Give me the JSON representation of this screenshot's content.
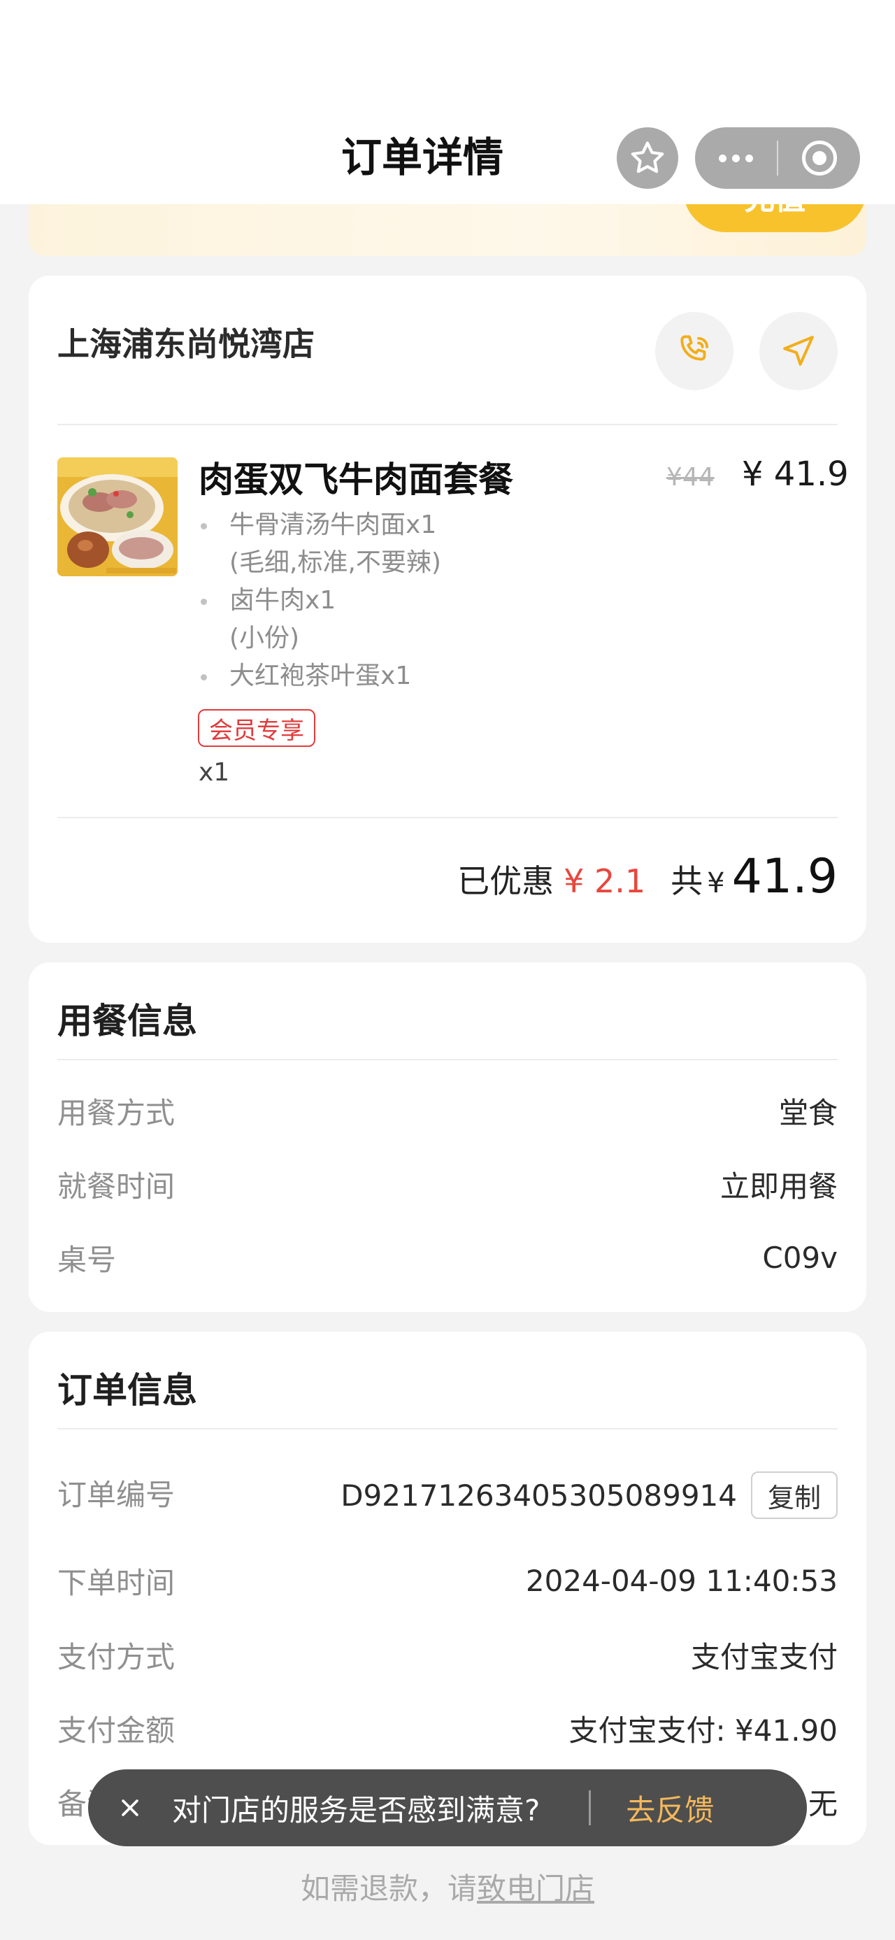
{
  "header": {
    "title": "订单详情"
  },
  "banner": {
    "button_label": "充值"
  },
  "store": {
    "name": "上海浦东尚悦湾店"
  },
  "product": {
    "name": "肉蛋双飞牛肉面套餐",
    "original_price": "¥44",
    "price": "¥ 41.9",
    "sub_items": [
      {
        "name": "牛骨清汤牛肉面",
        "qty": "x1",
        "spec": "(毛细,标准,不要辣)"
      },
      {
        "name": "卤牛肉",
        "qty": "x1",
        "spec": "(小份)"
      },
      {
        "name": "大红袍茶叶蛋",
        "qty": "x1",
        "spec": ""
      }
    ],
    "tag": "会员专享",
    "qty": "x1",
    "image_caption": "*图片仅供参考,具体以实物为准"
  },
  "summary": {
    "discount_label": "已优惠",
    "discount_value": "¥ 2.1",
    "total_label": "共",
    "total_currency": "¥",
    "total_value": "41.9"
  },
  "dining": {
    "title": "用餐信息",
    "rows": [
      {
        "label": "用餐方式",
        "value": "堂食"
      },
      {
        "label": "就餐时间",
        "value": "立即用餐"
      },
      {
        "label": "桌号",
        "value": "C09v"
      }
    ]
  },
  "order": {
    "title": "订单信息",
    "copy_label": "复制",
    "rows": [
      {
        "label": "订单编号",
        "value": "D92171263405305089914"
      },
      {
        "label": "下单时间",
        "value": "2024-04-09 11:40:53"
      },
      {
        "label": "支付方式",
        "value": "支付宝支付"
      },
      {
        "label": "支付金额",
        "value": "支付宝支付: ¥41.90"
      },
      {
        "label": "备注信息",
        "value": "无"
      }
    ]
  },
  "toast": {
    "text": "对门店的服务是否感到满意?",
    "action": "去反馈"
  },
  "footer": {
    "prefix": "如需退款，请",
    "link": "致电门店"
  },
  "colors": {
    "accent_yellow": "#f8c22d",
    "discount_red": "#e8473e",
    "tag_red": "#e03c3c",
    "feedback_orange": "#f5b85b"
  }
}
